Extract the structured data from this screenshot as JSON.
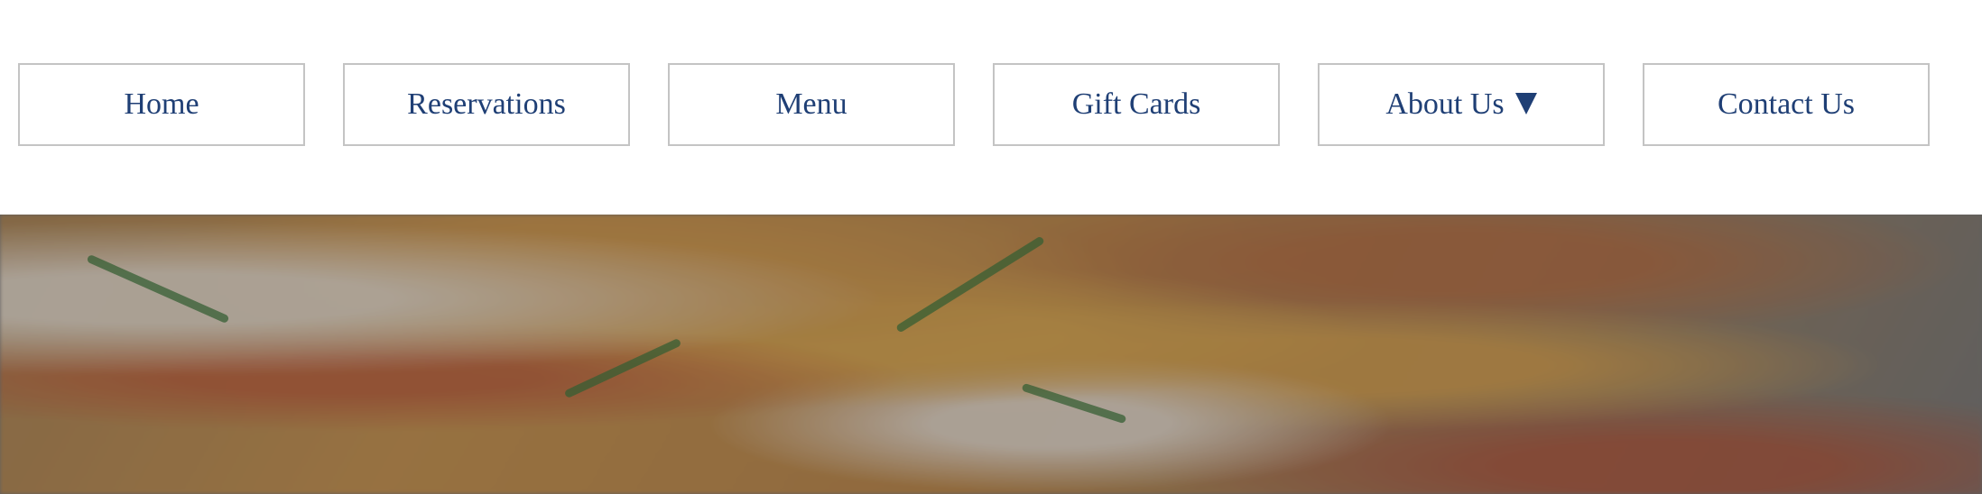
{
  "navigation": {
    "items": [
      {
        "label": "Home",
        "has_dropdown": false
      },
      {
        "label": "Reservations",
        "has_dropdown": false
      },
      {
        "label": "Menu",
        "has_dropdown": false
      },
      {
        "label": "Gift Cards",
        "has_dropdown": false
      },
      {
        "label": "About Us",
        "has_dropdown": true
      },
      {
        "label": "Contact Us",
        "has_dropdown": false
      }
    ]
  },
  "colors": {
    "nav_text": "#1f3f75",
    "nav_border": "#c4c4c4",
    "background": "#ffffff",
    "hero_overlay": "#6b6b6b"
  },
  "icons": {
    "dropdown": "caret-down-icon"
  }
}
